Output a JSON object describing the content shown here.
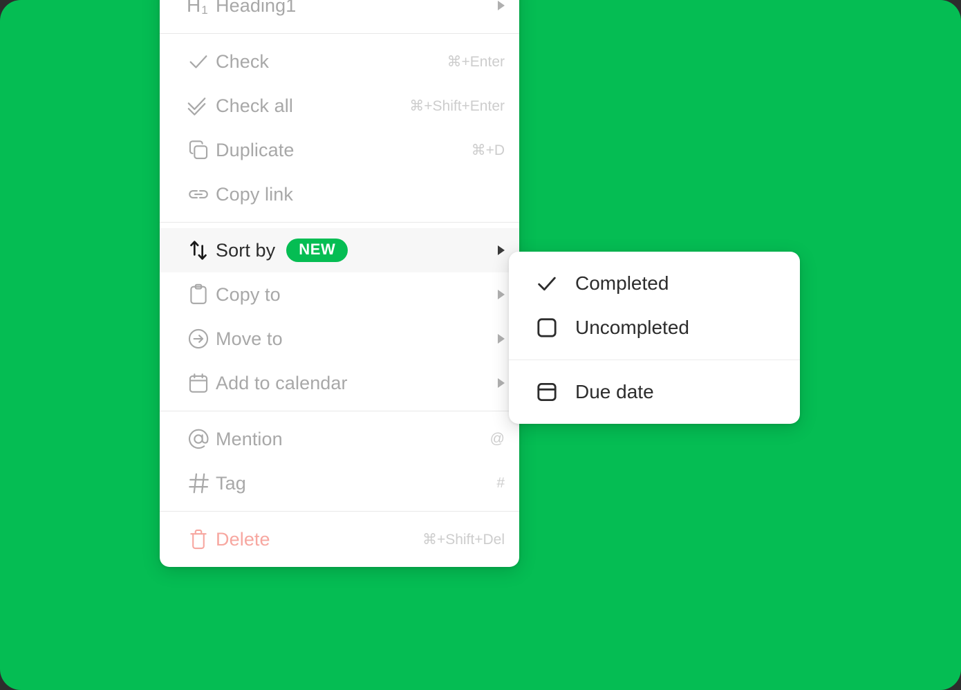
{
  "theme": {
    "background_color": "#05bd53",
    "panel_color": "#ffffff",
    "accent_color": "#05bd53",
    "label_color": "#a8a8a8",
    "active_label_color": "#2c2c2c",
    "danger_color": "#f7a7a0",
    "shortcut_color": "#cdcdcd"
  },
  "context_menu": {
    "groups": [
      {
        "items": [
          {
            "icon": "heading1-icon",
            "label": "Heading1",
            "shortcut": "",
            "submenu": true,
            "state": "normal"
          }
        ]
      },
      {
        "items": [
          {
            "icon": "check-icon",
            "label": "Check",
            "shortcut": "⌘+Enter",
            "submenu": false,
            "state": "normal"
          },
          {
            "icon": "check-all-icon",
            "label": "Check all",
            "shortcut": "⌘+Shift+Enter",
            "submenu": false,
            "state": "normal"
          },
          {
            "icon": "duplicate-icon",
            "label": "Duplicate",
            "shortcut": "⌘+D",
            "submenu": false,
            "state": "normal"
          },
          {
            "icon": "link-icon",
            "label": "Copy link",
            "shortcut": "",
            "submenu": false,
            "state": "normal"
          }
        ]
      },
      {
        "items": [
          {
            "icon": "sort-icon",
            "label": "Sort by",
            "badge": "NEW",
            "shortcut": "",
            "submenu": true,
            "state": "active"
          },
          {
            "icon": "clipboard-icon",
            "label": "Copy to",
            "shortcut": "",
            "submenu": true,
            "state": "normal"
          },
          {
            "icon": "move-to-icon",
            "label": "Move to",
            "shortcut": "",
            "submenu": true,
            "state": "normal"
          },
          {
            "icon": "calendar-icon",
            "label": "Add to calendar",
            "shortcut": "",
            "submenu": true,
            "state": "normal"
          }
        ]
      },
      {
        "items": [
          {
            "icon": "at-icon",
            "label": "Mention",
            "shortcut": "@",
            "submenu": false,
            "state": "normal"
          },
          {
            "icon": "hash-icon",
            "label": "Tag",
            "shortcut": "#",
            "submenu": false,
            "state": "normal"
          }
        ]
      },
      {
        "items": [
          {
            "icon": "trash-icon",
            "label": "Delete",
            "shortcut": "⌘+Shift+Del",
            "submenu": false,
            "state": "danger"
          }
        ]
      }
    ]
  },
  "sort_submenu": {
    "groups": [
      {
        "items": [
          {
            "icon": "checkmark-icon",
            "label": "Completed"
          },
          {
            "icon": "empty-checkbox-icon",
            "label": "Uncompleted"
          }
        ]
      },
      {
        "items": [
          {
            "icon": "due-date-icon",
            "label": "Due date"
          }
        ]
      }
    ]
  }
}
